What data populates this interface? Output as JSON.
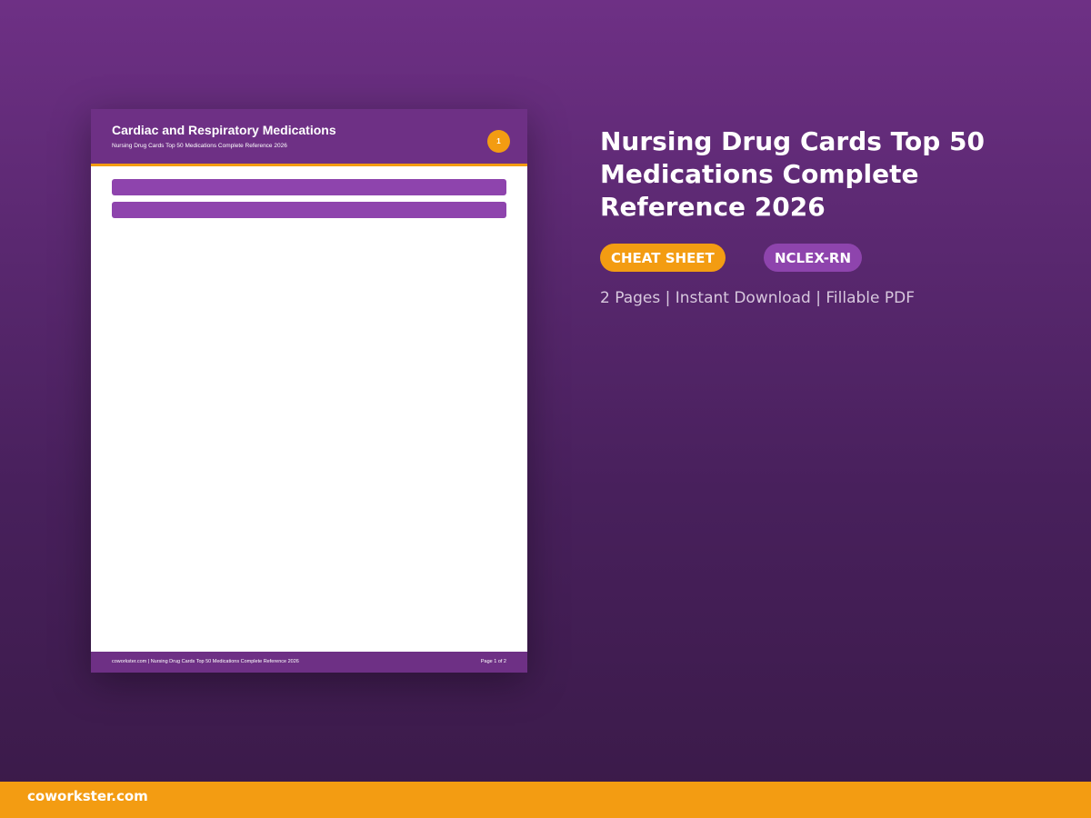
{
  "document_preview": {
    "title": "Cardiac and Respiratory Medications",
    "subtitle": "Nursing Drug Cards Top 50 Medications Complete Reference 2026",
    "page_badge": "1",
    "footer_left": "coworkster.com | Nursing Drug Cards Top 50 Medications Complete Reference 2026",
    "footer_right": "Page 1 of 2"
  },
  "product": {
    "title": "Nursing Drug Cards Top 50 Medications Complete Reference 2026",
    "tags": [
      {
        "label": "CHEAT SHEET",
        "color": "#f39c12"
      },
      {
        "label": "NCLEX-RN",
        "color": "#8e44ad"
      }
    ],
    "meta": "2 Pages | Instant Download | Fillable PDF"
  },
  "brand": {
    "name": "coworkster.com",
    "color": "#f39c12"
  },
  "colors": {
    "primary_purple": "#6e3085",
    "accent_orange": "#f39c12",
    "tag_purple": "#8e44ad"
  }
}
